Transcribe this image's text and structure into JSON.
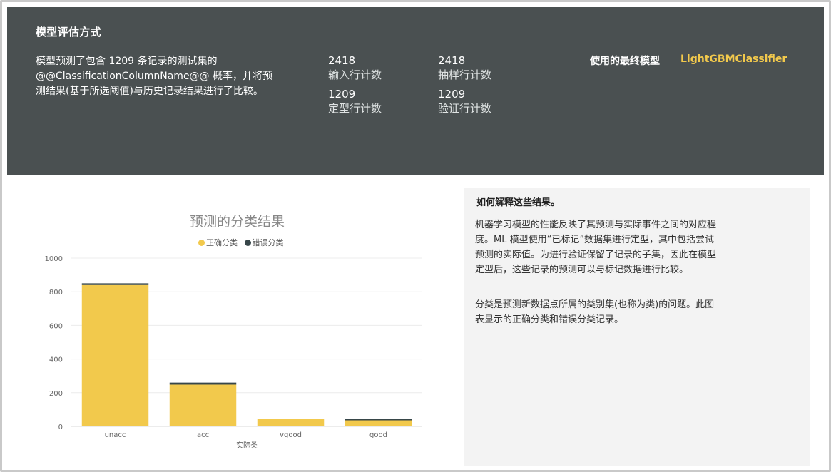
{
  "header": {
    "title": "模型评估方式",
    "description": "模型预测了包含 1209 条记录的测试集的 @@ClassificationColumnName@@ 概率，并将预测结果(基于所选阈值)与历史记录结果进行了比较。",
    "stats": [
      {
        "value": "2418",
        "label": "输入行计数"
      },
      {
        "value": "2418",
        "label": "抽样行计数"
      },
      {
        "value": "1209",
        "label": "定型行计数"
      },
      {
        "value": "1209",
        "label": "验证行计数"
      }
    ],
    "final_model_label": "使用的最终模型",
    "final_model_value": "LightGBMClassifier"
  },
  "colors": {
    "header_bg": "#4a5051",
    "correct": "#f2c94c",
    "incorrect": "#374649",
    "accent_text": "#f2c94c"
  },
  "chart_data": {
    "type": "bar",
    "stacked": true,
    "title": "预测的分类结果",
    "xlabel": "实际类",
    "ylabel": "",
    "categories": [
      "unacc",
      "acc",
      "vgood",
      "good"
    ],
    "series": [
      {
        "name": "正确分类",
        "values": [
          840,
          248,
          44,
          36
        ]
      },
      {
        "name": "错误分类",
        "values": [
          10,
          12,
          2,
          7
        ]
      }
    ],
    "ylim": [
      0,
      1000
    ],
    "yticks": [
      0,
      200,
      400,
      600,
      800,
      1000
    ],
    "grid": true,
    "legend_position": "top-center"
  },
  "info": {
    "title": "如何解释这些结果。",
    "paragraph1": "机器学习模型的性能反映了其预测与实际事件之间的对应程度。ML 模型使用“已标记”数据集进行定型，其中包括尝试预测的实际值。为进行验证保留了记录的子集，因此在模型定型后，这些记录的预测可以与标记数据进行比较。",
    "paragraph2": "分类是预测新数据点所属的类别集(也称为类)的问题。此图表显示的正确分类和错误分类记录。"
  }
}
